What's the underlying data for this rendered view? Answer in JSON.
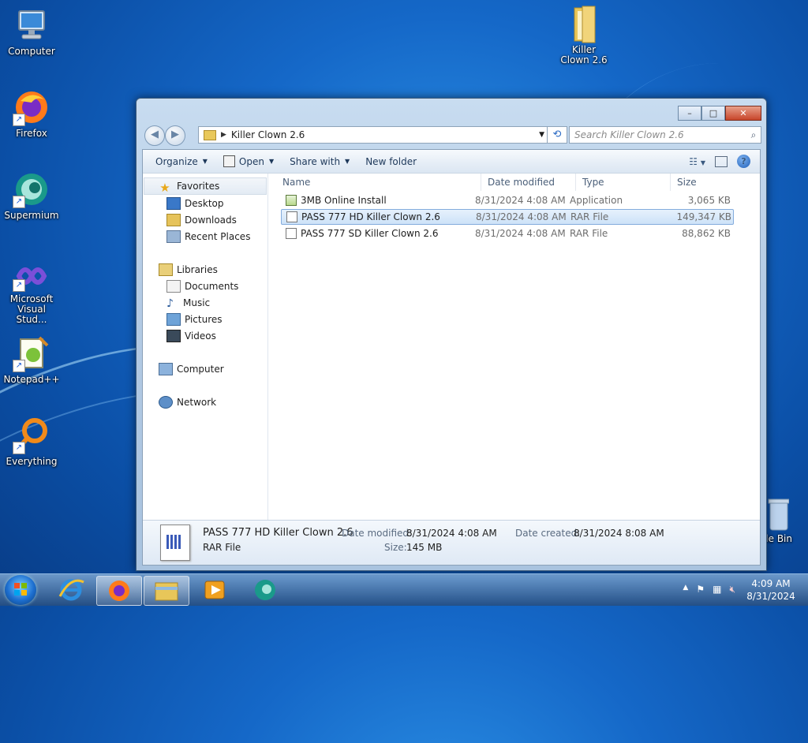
{
  "desktop": {
    "icons": [
      {
        "label": "Computer"
      },
      {
        "label": "Firefox"
      },
      {
        "label": "Supermium"
      },
      {
        "label": "Microsoft Visual Stud..."
      },
      {
        "label": "Notepad++"
      },
      {
        "label": "Everything"
      },
      {
        "label": "Killer Clown 2.6"
      },
      {
        "label": "cle Bin"
      }
    ]
  },
  "window": {
    "address": "Killer Clown 2.6",
    "search_placeholder": "Search Killer Clown 2.6",
    "caption": {
      "minimize": "–",
      "maximize": "□",
      "close": "✕"
    },
    "toolbar": {
      "organize": "Organize",
      "open": "Open",
      "share_with": "Share with",
      "new_folder": "New folder"
    },
    "nav": {
      "favorites": "Favorites",
      "desktop": "Desktop",
      "downloads": "Downloads",
      "recent_places": "Recent Places",
      "libraries": "Libraries",
      "documents": "Documents",
      "music": "Music",
      "pictures": "Pictures",
      "videos": "Videos",
      "computer": "Computer",
      "network": "Network"
    },
    "columns": {
      "name": "Name",
      "date": "Date modified",
      "type": "Type",
      "size": "Size"
    },
    "files": [
      {
        "name": "3MB Online Install",
        "date": "8/31/2024 4:08 AM",
        "type": "Application",
        "size": "3,065 KB"
      },
      {
        "name": "PASS 777 HD Killer Clown 2.6",
        "date": "8/31/2024 4:08 AM",
        "type": "RAR File",
        "size": "149,347 KB"
      },
      {
        "name": "PASS 777 SD Killer Clown 2.6",
        "date": "8/31/2024 4:08 AM",
        "type": "RAR File",
        "size": "88,862 KB"
      }
    ],
    "details": {
      "name": "PASS 777 HD Killer Clown 2.6",
      "type": "RAR File",
      "date_modified_label": "Date modified:",
      "date_modified": "8/31/2024 4:08 AM",
      "size_label": "Size:",
      "size": "145 MB",
      "date_created_label": "Date created:",
      "date_created": "8/31/2024 8:08 AM"
    }
  },
  "taskbar": {
    "time": "4:09 AM",
    "date": "8/31/2024"
  },
  "colors": {
    "selection": "#cde2f8",
    "accent": "#1f5fb8"
  }
}
